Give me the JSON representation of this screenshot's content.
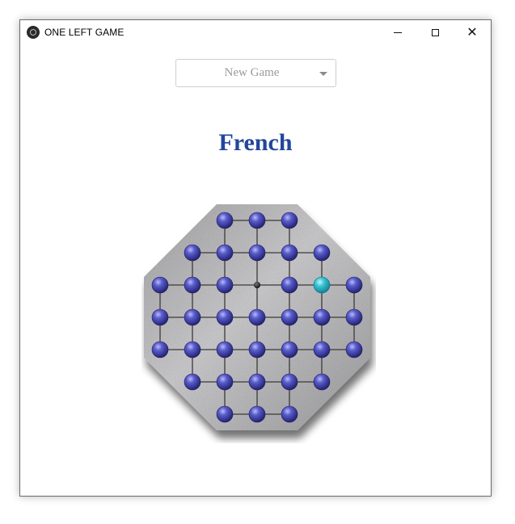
{
  "window": {
    "title": "ONE LEFT GAME",
    "controls": {
      "minimize": "minimize",
      "maximize": "maximize",
      "close": "close"
    }
  },
  "game_select": {
    "selected": "New Game"
  },
  "board": {
    "variant": "French",
    "shape": "octagon",
    "colors": {
      "peg": "#3a3ba0",
      "selected_peg": "#2bb6c6",
      "empty_hole": "#1a1a1a",
      "board_surface": "#b5b5b8",
      "title": "#23469a"
    },
    "rows": [
      [
        "none",
        "none",
        "peg",
        "peg",
        "peg",
        "none",
        "none"
      ],
      [
        "none",
        "peg",
        "peg",
        "peg",
        "peg",
        "peg",
        "none"
      ],
      [
        "peg",
        "peg",
        "peg",
        "empty",
        "peg",
        "selected",
        "peg"
      ],
      [
        "peg",
        "peg",
        "peg",
        "peg",
        "peg",
        "peg",
        "peg"
      ],
      [
        "peg",
        "peg",
        "peg",
        "peg",
        "peg",
        "peg",
        "peg"
      ],
      [
        "none",
        "peg",
        "peg",
        "peg",
        "peg",
        "peg",
        "none"
      ],
      [
        "none",
        "none",
        "peg",
        "peg",
        "peg",
        "none",
        "none"
      ]
    ]
  }
}
